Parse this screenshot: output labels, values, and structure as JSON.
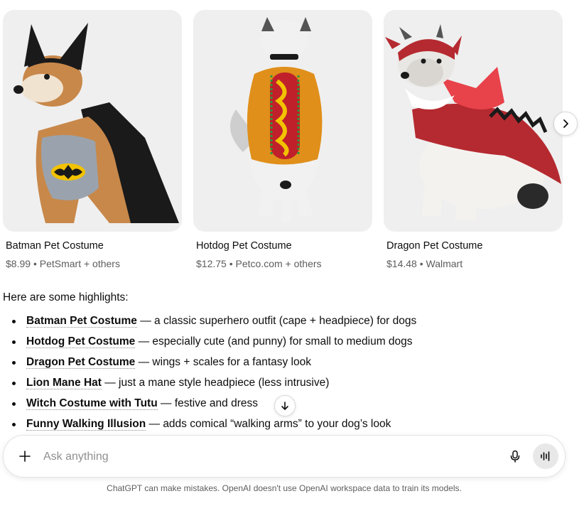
{
  "products": [
    {
      "title": "Batman Pet Costume",
      "price": "$8.99",
      "sellers": "PetSmart + others",
      "image_icon": "batman-dog-image"
    },
    {
      "title": "Hotdog Pet Costume",
      "price": "$12.75",
      "sellers": "Petco.com + others",
      "image_icon": "hotdog-dog-image"
    },
    {
      "title": "Dragon Pet Costume",
      "price": "$14.48",
      "sellers": "Walmart",
      "image_icon": "dragon-dog-image"
    }
  ],
  "carousel": {
    "next_icon": "chevron-right-icon"
  },
  "message": {
    "intro": "Here are some highlights:",
    "highlights": [
      {
        "name": "Batman Pet Costume",
        "desc": " — a classic superhero outfit (cape + headpiece) for dogs"
      },
      {
        "name": "Hotdog Pet Costume",
        "desc": " — especially cute (and punny) for small to medium dogs"
      },
      {
        "name": "Dragon Pet Costume",
        "desc": " — wings + scales for a fantasy look"
      },
      {
        "name": "Lion Mane Hat",
        "desc": " — just a mane style headpiece (less intrusive)"
      },
      {
        "name": "Witch Costume with Tutu",
        "desc": " — festive and dress"
      },
      {
        "name": "Funny Walking Illusion",
        "desc": " — adds comical “walking arms” to your dog’s look"
      }
    ]
  },
  "composer": {
    "placeholder": "Ask anything",
    "plus_icon": "plus-icon",
    "mic_icon": "microphone-icon",
    "voice_icon": "voice-mode-icon"
  },
  "scroll_icon": "arrow-down-icon",
  "footer": {
    "disclaimer": "ChatGPT can make mistakes. OpenAI doesn't use OpenAI workspace data to train its models."
  },
  "colors": {
    "text": "#0d0d0d",
    "muted": "#5d5d5d",
    "card_bg": "#efefef",
    "accent_red": "#c0202a"
  }
}
